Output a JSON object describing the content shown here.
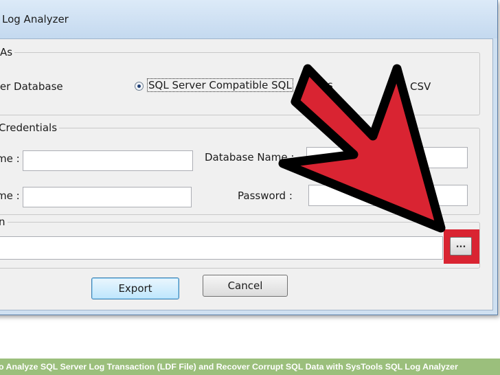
{
  "window": {
    "title": "Log Analyzer"
  },
  "export_as": {
    "legend": "As",
    "option_sql_server_db": "ver Database",
    "option_sql_script": "SQL Server Compatible SQL",
    "option_sql_script_tail": "ts",
    "option_csv": "CSV",
    "selected": "SQL Server Compatible SQL"
  },
  "credentials": {
    "legend": "Credentials",
    "server_label": "me :",
    "server_value": "",
    "username_label": "me :",
    "username_value": "",
    "database_label": "Database Name :",
    "database_value": "",
    "password_label": "Password :",
    "password_value": ""
  },
  "destination": {
    "legend": "n",
    "path_value": "",
    "browse_label": "..."
  },
  "buttons": {
    "export": "Export",
    "cancel": "Cancel"
  },
  "colors": {
    "highlight": "#d92432",
    "caption_bg": "#9bbf7c",
    "title_bar": "#cfe0f1"
  },
  "caption": "o Analyze SQL Server Log Transaction (LDF File) and Recover Corrupt SQL Data with SysTools SQL Log Analyzer"
}
